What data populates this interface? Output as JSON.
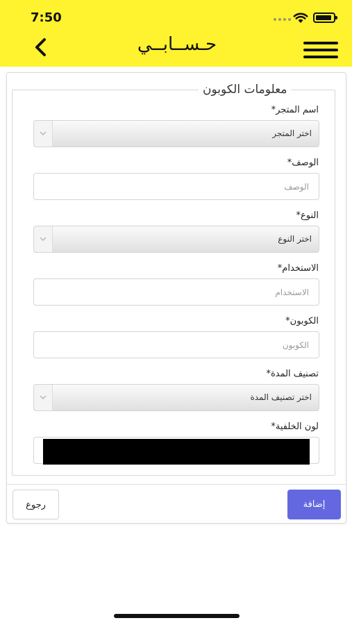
{
  "status_bar": {
    "time": "7:50"
  },
  "header": {
    "title": "حـســابــي",
    "background": "#fff22e"
  },
  "form": {
    "legend": "معلومات الكوبون",
    "store": {
      "label": "اسم المتجر*",
      "value": "اختر المتجر"
    },
    "description": {
      "label": "الوصف*",
      "placeholder": "الوصف"
    },
    "type": {
      "label": "النوع*",
      "value": "اختر النوع"
    },
    "usage": {
      "label": "الاستخدام*",
      "placeholder": "الاستخدام"
    },
    "coupon": {
      "label": "الكوبون*",
      "placeholder": "الكوبون"
    },
    "duration": {
      "label": "تصنيف المدة*",
      "value": "اختر تصنيف المدة"
    },
    "bg_color": {
      "label": "لون الخلفية*",
      "value": "#000000"
    }
  },
  "actions": {
    "back_label": "رجوع",
    "add_label": "إضافة",
    "add_color": "#6368e0"
  }
}
